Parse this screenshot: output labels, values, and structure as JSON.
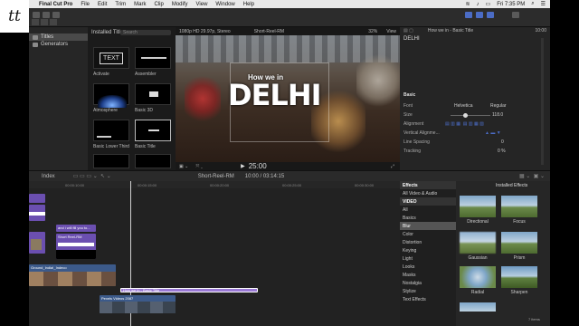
{
  "logo_text": "tt",
  "menubar": {
    "app_name": "Final Cut Pro",
    "items": [
      "File",
      "Edit",
      "Trim",
      "Mark",
      "Clip",
      "Modify",
      "View",
      "Window",
      "Help"
    ],
    "clock": "Fri 7:35 PM"
  },
  "browser": {
    "sidebar": [
      {
        "label": "Titles"
      },
      {
        "label": "Generators"
      }
    ],
    "header": "Installed Titles",
    "search_placeholder": "Search",
    "thumbs": [
      "Activate",
      "Assembler",
      "Atmosphere",
      "Basic 3D",
      "Basic Lower Third",
      "Basic Title"
    ]
  },
  "viewer": {
    "format": "1080p HD 29.97p, Stereo",
    "project": "Short-Reel-RM",
    "zoom": "32%",
    "view_menu": "View",
    "overlay_small": "How we in",
    "overlay_big": "DELHI",
    "timecode": "25:00"
  },
  "inspector": {
    "header_title": "How we in - Basic Title",
    "header_time": "10:00",
    "title": "DELHI",
    "section": "Basic",
    "rows": [
      {
        "label": "Font",
        "value": "Helvetica",
        "value2": "Regular"
      },
      {
        "label": "Size",
        "value": "118.0"
      },
      {
        "label": "Alignment",
        "value": ""
      },
      {
        "label": "Vertical Alignme...",
        "value": ""
      },
      {
        "label": "Line Spacing",
        "value": "0"
      },
      {
        "label": "Tracking",
        "value": "0 %"
      }
    ]
  },
  "timeline": {
    "index_label": "Index",
    "project": "Short-Reel-RM",
    "duration": "10:00 / 03:14:15",
    "ruler": [
      "00:00:10:00",
      "00:00:15:00",
      "00:00:20:00",
      "00:00:25:00",
      "00:00:30:00"
    ],
    "clip_labels": {
      "purple_top": "and i will fill you to...",
      "purple_short": "Short Reel-RM",
      "main": "Ground_India!_Indeco",
      "title_clip": "How we in - Basic Title",
      "bottom": "Pexels Videos 2087"
    }
  },
  "effects": {
    "header": "Effects",
    "installed": "Installed Effects",
    "categories": [
      "All Video & Audio",
      "VIDEO",
      "All",
      "Basics",
      "Blur",
      "Color",
      "Distortion",
      "Keying",
      "Light",
      "Looks",
      "Masks",
      "Nostalgia",
      "Stylize",
      "Text Effects"
    ],
    "selected_category": "Blur",
    "items": [
      "Directional",
      "Focus",
      "Gaussian",
      "Prism",
      "Radial",
      "Sharpen"
    ],
    "count": "7 items"
  },
  "colors": {
    "accent": "#4b6cc5",
    "purple_clip": "#6b4fb0",
    "title_clip": "#9b7ad6"
  }
}
